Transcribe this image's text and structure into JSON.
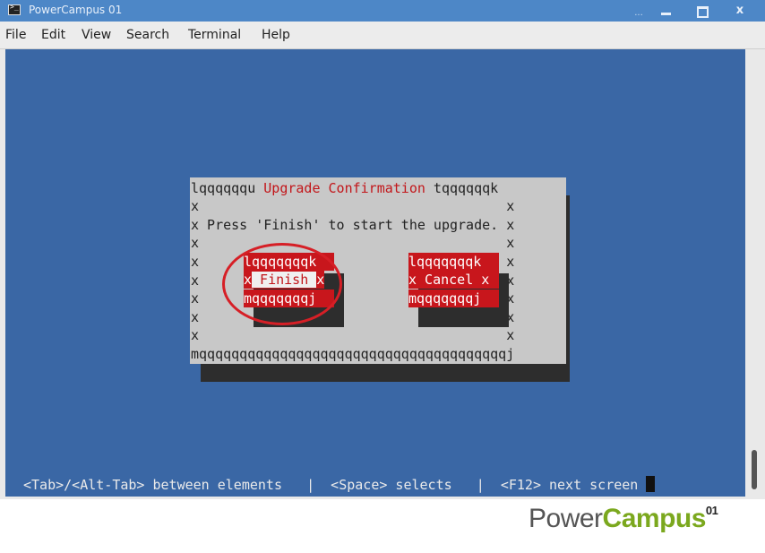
{
  "window": {
    "title": "PowerCampus 01",
    "controls": {
      "dots": "...",
      "close": "x"
    }
  },
  "menu": [
    "File",
    "Edit",
    "View",
    "Search",
    "Terminal",
    "Help"
  ],
  "dialog": {
    "top_left": "lqqqqqqu ",
    "title": "Upgrade Confirmation",
    "top_right": " tqqqqqqk",
    "message_line": "x Press 'Finish' to start the upgrade. x",
    "empty_line": "x                                      x",
    "bottom_border": "mqqqqqqqqqqqqqqqqqqqqqqqqqqqqqqqqqqqqqqj",
    "side": "x"
  },
  "buttons": {
    "finish": {
      "top": "lqqqqqqqk",
      "left": "x",
      "label": " Finish ",
      "right": "x",
      "bottom": "mqqqqqqqj"
    },
    "cancel": {
      "top": "lqqqqqqqk",
      "label": "x Cancel x",
      "bottom": "mqqqqqqqj"
    }
  },
  "status_bar": "<Tab>/<Alt-Tab> between elements   |  <Space> selects   |  <F12> next screen ",
  "brand": {
    "power": "Power",
    "campus": "Campus",
    "superscript": "01"
  },
  "colors": {
    "terminal_bg": "#3a67a5",
    "dialog_bg": "#c8c8c8",
    "accent_red": "#c2161a",
    "titlebar": "#4d87c7"
  }
}
